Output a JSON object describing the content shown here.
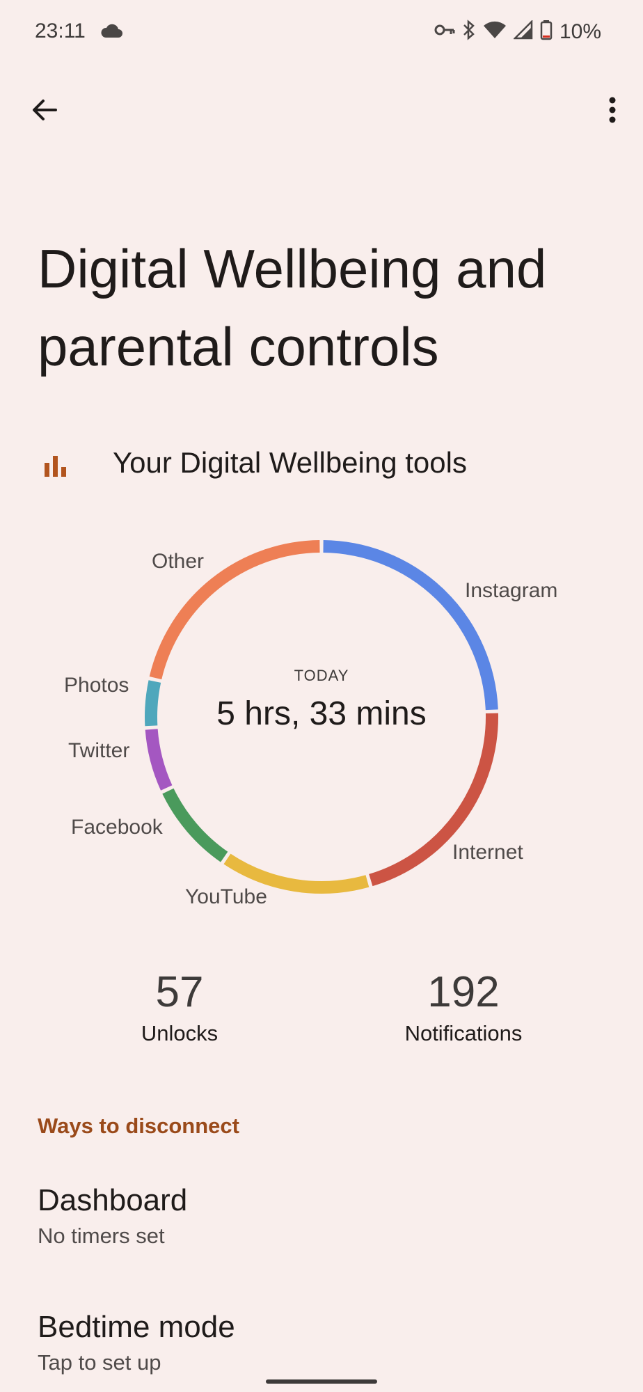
{
  "status_bar": {
    "time": "23:11",
    "battery": "10%"
  },
  "header": {
    "title": "Digital Wellbeing and parental controls"
  },
  "tools": {
    "label": "Your Digital Wellbeing tools"
  },
  "usage": {
    "period": "TODAY",
    "total": "5 hrs, 33 mins",
    "apps": [
      {
        "name": "Instagram",
        "share": 0.245,
        "color": "#5b86e5"
      },
      {
        "name": "Internet",
        "share": 0.21,
        "color": "#cc5444"
      },
      {
        "name": "YouTube",
        "share": 0.14,
        "color": "#e8b93f"
      },
      {
        "name": "Facebook",
        "share": 0.085,
        "color": "#4a9a5c"
      },
      {
        "name": "Twitter",
        "share": 0.06,
        "color": "#a457c1"
      },
      {
        "name": "Photos",
        "share": 0.045,
        "color": "#4fa7bc"
      },
      {
        "name": "Other",
        "share": 0.215,
        "color": "#ee7f55"
      }
    ]
  },
  "stats": {
    "unlocks": {
      "value": "57",
      "label": "Unlocks"
    },
    "notifications": {
      "value": "192",
      "label": "Notifications"
    }
  },
  "section": {
    "title": "Ways to disconnect"
  },
  "items": [
    {
      "title": "Dashboard",
      "summary": "No timers set"
    },
    {
      "title": "Bedtime mode",
      "summary": "Tap to set up"
    }
  ]
}
